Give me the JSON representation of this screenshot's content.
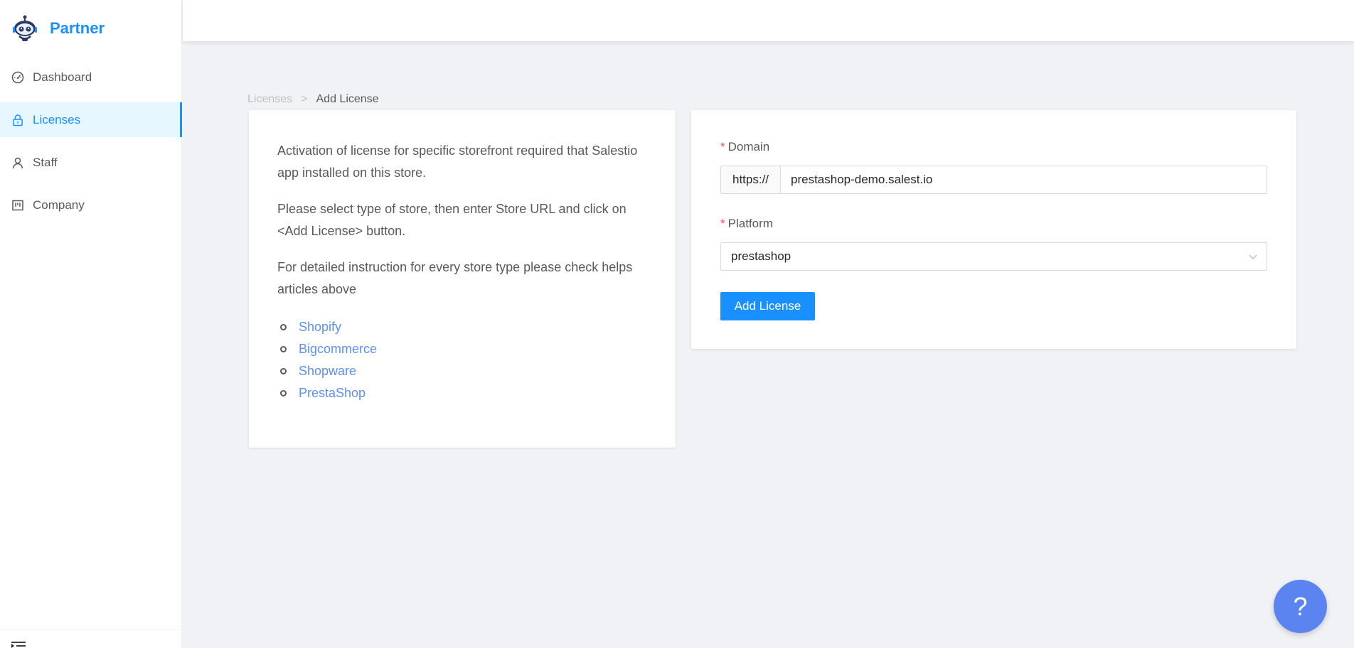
{
  "app": {
    "logo_text": "Partner"
  },
  "sidebar": {
    "items": [
      {
        "label": "Dashboard",
        "icon": "dashboard-icon",
        "active": false
      },
      {
        "label": "Licenses",
        "icon": "lock-icon",
        "active": true
      },
      {
        "label": "Staff",
        "icon": "user-icon",
        "active": false
      },
      {
        "label": "Company",
        "icon": "company-icon",
        "active": false
      }
    ],
    "footer_icon": "menu-fold-icon"
  },
  "breadcrumb": {
    "parent": "Licenses",
    "separator": ">",
    "current": "Add License"
  },
  "info": {
    "paragraphs": [
      "Activation of license for specific storefront required that Salestio app installed on this store.",
      "Please select type of store, then enter Store URL and click on <Add License> button.",
      "For detailed instruction for every store type please check helps articles above"
    ],
    "links": [
      "Shopify",
      "Bigcommerce",
      "Shopware",
      "PrestaShop"
    ]
  },
  "form": {
    "required_mark": "*",
    "domain_label": "Domain",
    "domain_prefix": "https://",
    "domain_value": "prestashop-demo.salest.io",
    "platform_label": "Platform",
    "platform_value": "prestashop",
    "submit_label": "Add License"
  },
  "help": {
    "label": "?"
  },
  "colors": {
    "primary": "#1890ff",
    "link": "#5b8ff9",
    "required": "#ff4d4f",
    "help_fab": "#5b84f0",
    "background": "#f0f2f5"
  }
}
